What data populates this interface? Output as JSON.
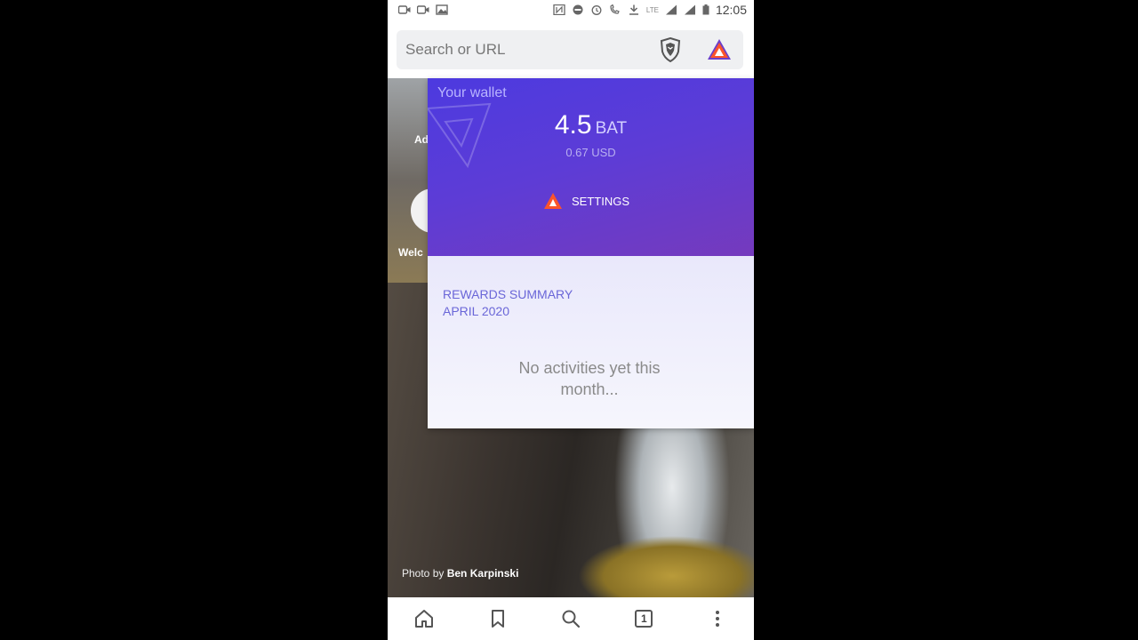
{
  "status_bar": {
    "time": "12:05",
    "network": "LTE",
    "icons": [
      "video-icon",
      "video-icon",
      "image-icon",
      "nfc-icon",
      "dnd-icon",
      "alarm-icon",
      "wifi-calling-icon",
      "download-icon",
      "signal-icon",
      "signal-icon",
      "battery-icon"
    ]
  },
  "url_bar": {
    "placeholder": "Search or URL",
    "icons": [
      "brave-shield-icon",
      "brave-rewards-icon"
    ]
  },
  "wallet": {
    "title": "Your wallet",
    "balance": "4.5",
    "unit": "BAT",
    "usd": "0.67 USD",
    "settings_label": "SETTINGS"
  },
  "summary": {
    "title_line1": "REWARDS SUMMARY",
    "title_line2": "APRIL 2020",
    "empty_text": "No activities yet this month..."
  },
  "background": {
    "credit_prefix": "Photo by",
    "credit_author": "Ben Karpinski",
    "ghost_text_1": "Ad",
    "ghost_text_2": "Welc"
  },
  "bottom_bar": {
    "tab_count": "1",
    "icons": [
      "home-icon",
      "bookmark-icon",
      "search-icon",
      "tabs-icon",
      "more-icon"
    ]
  },
  "colors": {
    "wallet_gradient_start": "#4b3ae0",
    "wallet_gradient_end": "#7a3ab8",
    "summary_text": "#6a66d8",
    "brave_orange": "#fb542b"
  }
}
